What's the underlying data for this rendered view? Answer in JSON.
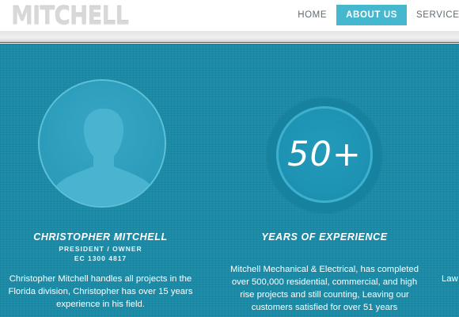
{
  "header": {
    "logo": "MITCHELL",
    "nav": [
      {
        "label": "HOME",
        "active": false
      },
      {
        "label": "ABOUT US",
        "active": true
      },
      {
        "label": "SERVICES",
        "active": false
      }
    ]
  },
  "profile": {
    "name": "CHRISTOPHER MITCHELL",
    "role": "PRESIDENT / OWNER",
    "license": "EC 1300 4817",
    "bio": "Christopher Mitchell handles all projects in the Florida division, Christopher has over 15 years experience in his field.",
    "avatar_icon": "person-silhouette-icon"
  },
  "experience": {
    "number": "50+",
    "title": "YEARS OF EXPERIENCE",
    "body": "Mitchell Mechanical & Electrical, has completed over 500,000 residential, commercial, and high rise projects and still counting, Leaving our customers satisfied for over 51 years"
  },
  "third_column": {
    "fragment_text": "Law"
  },
  "colors": {
    "teal_background": "#1a8aa6",
    "nav_active": "#45b8cf",
    "logo": "#d8d8d8"
  }
}
